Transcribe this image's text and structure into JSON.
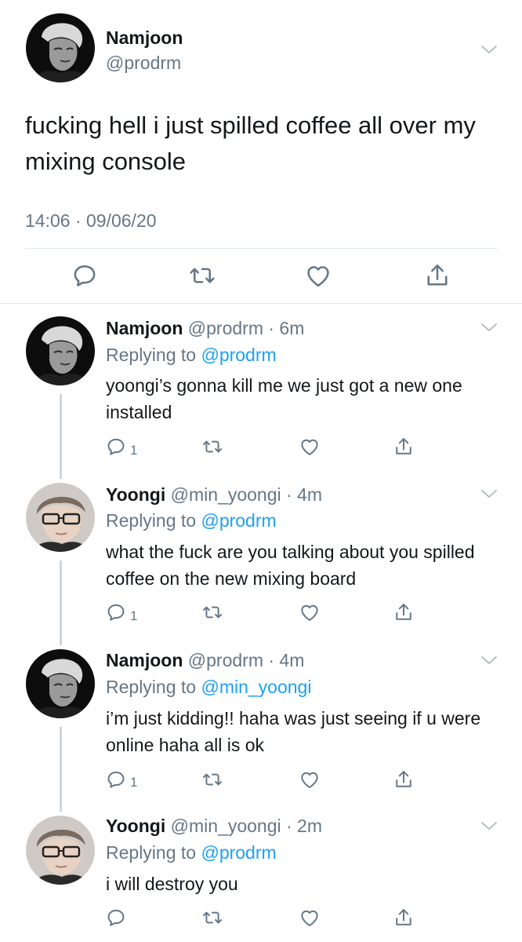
{
  "main_tweet": {
    "name": "Namjoon",
    "handle": "@prodrm",
    "text": "fucking hell i just spilled coffee all over my mixing console",
    "timestamp": "14:06 · 09/06/20"
  },
  "replies": [
    {
      "name": "Namjoon",
      "meta": "@prodrm · 6m",
      "replying_label": "Replying to",
      "replying_to": "@prodrm",
      "text": "yoongi’s gonna kill me we just got a new one installed",
      "reply_count": "1"
    },
    {
      "name": "Yoongi",
      "meta": "@min_yoongi · 4m",
      "replying_label": "Replying to",
      "replying_to": "@prodrm",
      "text": "what the fuck are you talking about you spilled coffee on the new mixing board",
      "reply_count": "1"
    },
    {
      "name": "Namjoon",
      "meta": "@prodrm · 4m",
      "replying_label": "Replying to",
      "replying_to": "@min_yoongi",
      "text": "i’m just kidding!! haha was just seeing if u were online haha all is ok",
      "reply_count": "1"
    },
    {
      "name": "Yoongi",
      "meta": "@min_yoongi · 2m",
      "replying_label": "Replying to",
      "replying_to": "@prodrm",
      "text": "i will destroy you",
      "reply_count": ""
    }
  ],
  "icons": {
    "reply": "reply-icon",
    "retweet": "retweet-icon",
    "like": "like-icon",
    "share": "share-icon",
    "more": "chevron-down-icon"
  },
  "colors": {
    "text": "#14171a",
    "secondary": "#657786",
    "link": "#1da1f2",
    "divider": "#e1e8ed",
    "thread_line": "#cdd6dd"
  }
}
